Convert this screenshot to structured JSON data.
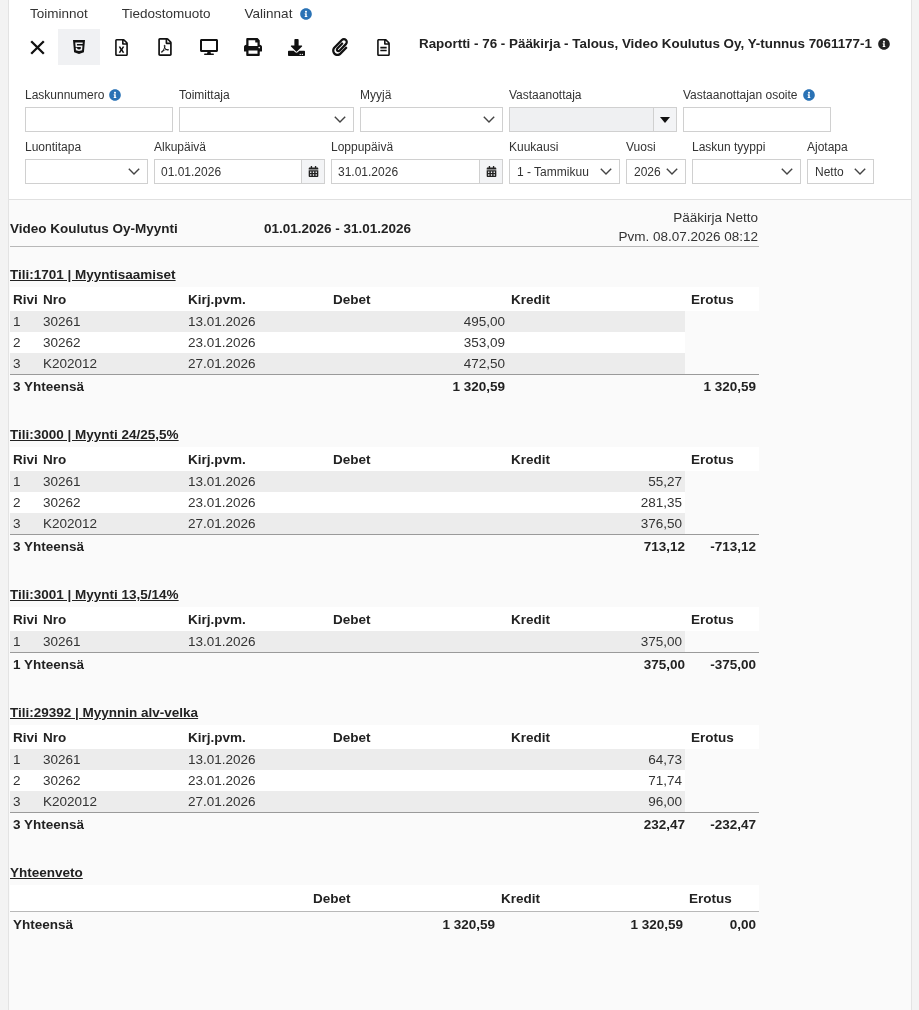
{
  "menu": [
    {
      "label": "Toiminnot",
      "info": false
    },
    {
      "label": "Tiedostomuoto",
      "info": false
    },
    {
      "label": "Valinnat",
      "info": true
    }
  ],
  "toolbar": [
    {
      "kind": "close",
      "selected": false
    },
    {
      "kind": "html",
      "selected": true
    },
    {
      "kind": "excel",
      "selected": false
    },
    {
      "kind": "pdf",
      "selected": false
    },
    {
      "kind": "screen",
      "selected": false
    },
    {
      "kind": "print",
      "selected": false
    },
    {
      "kind": "download",
      "selected": false
    },
    {
      "kind": "attach",
      "selected": false
    },
    {
      "kind": "document",
      "selected": false
    }
  ],
  "report_title": {
    "text": "Raportti - 76 - Pääkirja - Talous, Video Koulutus Oy, Y-tunnus 7061177-1",
    "info": true
  },
  "filter_rows": [
    {
      "fields": [
        {
          "label": "Laskunnumero",
          "kind": "text",
          "info": true,
          "disabled": false
        },
        {
          "label": "Toimittaja",
          "kind": "select",
          "info": false,
          "disabled": false
        },
        {
          "label": "Myyjä",
          "kind": "select",
          "info": false,
          "disabled": false
        },
        {
          "label": "Vastaanottaja",
          "kind": "combo",
          "info": false,
          "disabled": true
        },
        {
          "label": "Vastaanottajan osoite",
          "kind": "text",
          "info": true,
          "disabled": false
        }
      ]
    },
    {
      "fields": [
        {
          "label": "Luontitapa",
          "kind": "select",
          "info": false,
          "disabled": false
        },
        {
          "label": "Alkupäivä",
          "kind": "date",
          "info": false,
          "disabled": false,
          "value": "01.01.2026"
        },
        {
          "label": "Loppupäivä",
          "kind": "date",
          "info": false,
          "disabled": false,
          "value": "31.01.2026"
        },
        {
          "label": "Kuukausi",
          "kind": "select",
          "info": false,
          "disabled": false,
          "value": "1 - Tammikuu"
        },
        {
          "label": "Vuosi",
          "kind": "select",
          "info": false,
          "disabled": false,
          "value": "2026"
        },
        {
          "label": "Laskun tyyppi",
          "kind": "select",
          "info": false,
          "disabled": false
        },
        {
          "label": "Ajotapa",
          "kind": "select",
          "info": false,
          "disabled": false,
          "value": "Netto"
        }
      ]
    }
  ],
  "report_header": {
    "company": "Video Koulutus Oy-Myynti",
    "period": "01.01.2026 - 31.01.2026",
    "report_name": "Pääkirja Netto",
    "printed": "Pvm. 08.07.2026 08:12"
  },
  "accounts": [
    {
      "title": "Tili:1701 | Myyntisaamiset",
      "columns": [
        "Rivi",
        "Nro",
        "Kirj.pvm.",
        "Debet",
        "Kredit",
        "Erotus"
      ],
      "rows": [
        {
          "rivi": "1",
          "nro": "30261",
          "date": "13.01.2026",
          "debet": "495,00"
        },
        {
          "rivi": "2",
          "nro": "30262",
          "date": "23.01.2026",
          "debet": "353,09"
        },
        {
          "rivi": "3",
          "nro": "K202012",
          "date": "27.01.2026",
          "debet": "472,50"
        }
      ],
      "total": {
        "label": "3 Yhteensä",
        "debet": "1 320,59",
        "erotus": "1 320,59"
      }
    },
    {
      "title": "Tili:3000 | Myynti 24/25,5%",
      "columns": [
        "Rivi",
        "Nro",
        "Kirj.pvm.",
        "Debet",
        "Kredit",
        "Erotus"
      ],
      "rows": [
        {
          "rivi": "1",
          "nro": "30261",
          "date": "13.01.2026",
          "kredit": "55,27"
        },
        {
          "rivi": "2",
          "nro": "30262",
          "date": "23.01.2026",
          "kredit": "281,35"
        },
        {
          "rivi": "3",
          "nro": "K202012",
          "date": "27.01.2026",
          "kredit": "376,50"
        }
      ],
      "total": {
        "label": "3 Yhteensä",
        "kredit": "713,12",
        "erotus": "-713,12"
      }
    },
    {
      "title": "Tili:3001 | Myynti 13,5/14%",
      "columns": [
        "Rivi",
        "Nro",
        "Kirj.pvm.",
        "Debet",
        "Kredit",
        "Erotus"
      ],
      "rows": [
        {
          "rivi": "1",
          "nro": "30261",
          "date": "13.01.2026",
          "kredit": "375,00"
        }
      ],
      "total": {
        "label": "1 Yhteensä",
        "kredit": "375,00",
        "erotus": "-375,00"
      }
    },
    {
      "title": "Tili:29392 | Myynnin alv-velka",
      "columns": [
        "Rivi",
        "Nro",
        "Kirj.pvm.",
        "Debet",
        "Kredit",
        "Erotus"
      ],
      "rows": [
        {
          "rivi": "1",
          "nro": "30261",
          "date": "13.01.2026",
          "kredit": "64,73"
        },
        {
          "rivi": "2",
          "nro": "30262",
          "date": "23.01.2026",
          "kredit": "71,74"
        },
        {
          "rivi": "3",
          "nro": "K202012",
          "date": "27.01.2026",
          "kredit": "96,00"
        }
      ],
      "total": {
        "label": "3 Yhteensä",
        "kredit": "232,47",
        "erotus": "-232,47"
      }
    }
  ],
  "summary": {
    "title": "Yhteenveto",
    "columns": [
      "Debet",
      "Kredit",
      "Erotus"
    ],
    "total": {
      "label": "Yhteensä",
      "debet": "1 320,59",
      "kredit": "1 320,59",
      "erotus": "0,00"
    }
  }
}
